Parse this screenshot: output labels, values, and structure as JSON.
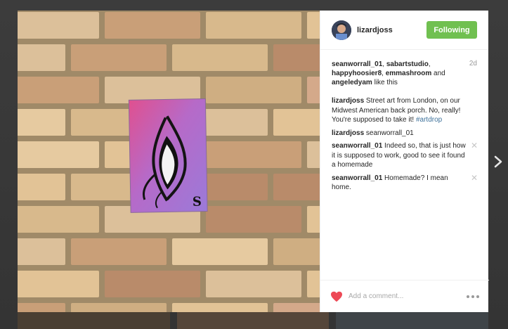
{
  "post": {
    "author": "lizardjoss",
    "follow_label": "Following",
    "time_ago": "2d",
    "likes": {
      "users": [
        "seanworrall_01",
        "sabartstudio",
        "happyhoosier8",
        "emmashroom",
        "angeledyam"
      ],
      "sep1": ", ",
      "and_text": " and ",
      "suffix": " like this"
    },
    "caption": {
      "user": "lizardjoss",
      "text": " Street art from London, on our Midwest American back porch. No, really! You're supposed to take it! ",
      "hashtag": "#artdrop"
    },
    "comments": [
      {
        "user": "lizardjoss",
        "text": " seanworrall_01"
      },
      {
        "user": "seanworrall_01",
        "text": " Indeed so, that is just how it is supposed to work, good to see it found a homemade"
      },
      {
        "user": "seanworrall_01",
        "text": " Homemade? I mean home."
      }
    ],
    "comment_placeholder": "Add a comment...",
    "artwork_signature": "S"
  },
  "colors": {
    "follow_green": "#70c050",
    "like_red": "#ed4956",
    "hashtag_blue": "#3f729b"
  },
  "icons": {
    "like": "heart-icon",
    "options": "more-dots-icon",
    "next": "chevron-right-icon",
    "delete": "close-icon"
  }
}
